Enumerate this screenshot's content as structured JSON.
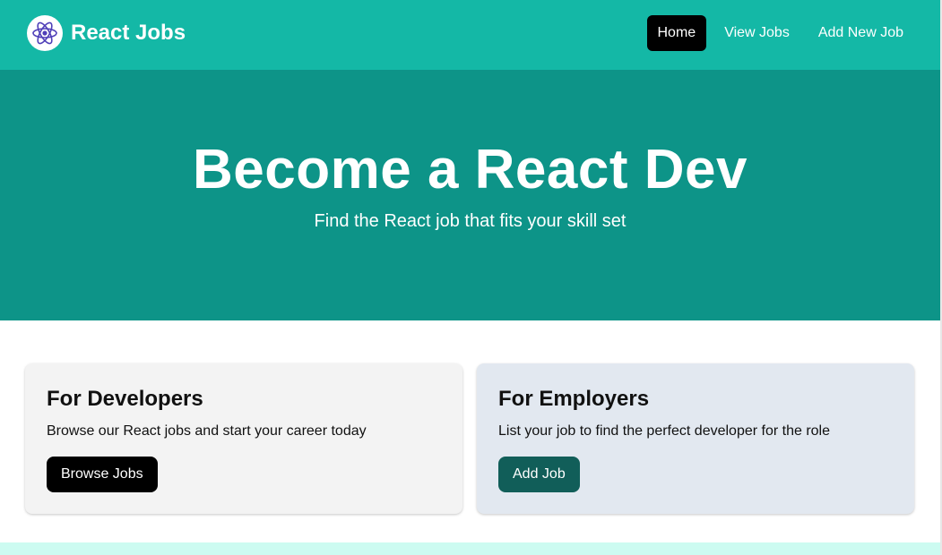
{
  "navbar": {
    "brand_name": "React Jobs",
    "logo_icon": "react-atom-icon",
    "links": [
      {
        "label": "Home",
        "active": true
      },
      {
        "label": "View Jobs",
        "active": false
      },
      {
        "label": "Add New Job",
        "active": false
      }
    ]
  },
  "hero": {
    "title": "Become a React Dev",
    "subtitle": "Find the React job that fits your skill set"
  },
  "cards": {
    "developers": {
      "title": "For Developers",
      "text": "Browse our React jobs and start your career today",
      "button_label": "Browse Jobs"
    },
    "employers": {
      "title": "For Employers",
      "text": "List your job to find the perfect developer for the role",
      "button_label": "Add Job"
    }
  },
  "colors": {
    "navbar_bg": "#14b8a6",
    "hero_bg": "#0d9488",
    "employer_button": "#115e59",
    "developer_card_bg": "#f3f3f3",
    "employer_card_bg": "#e2e8f0"
  }
}
